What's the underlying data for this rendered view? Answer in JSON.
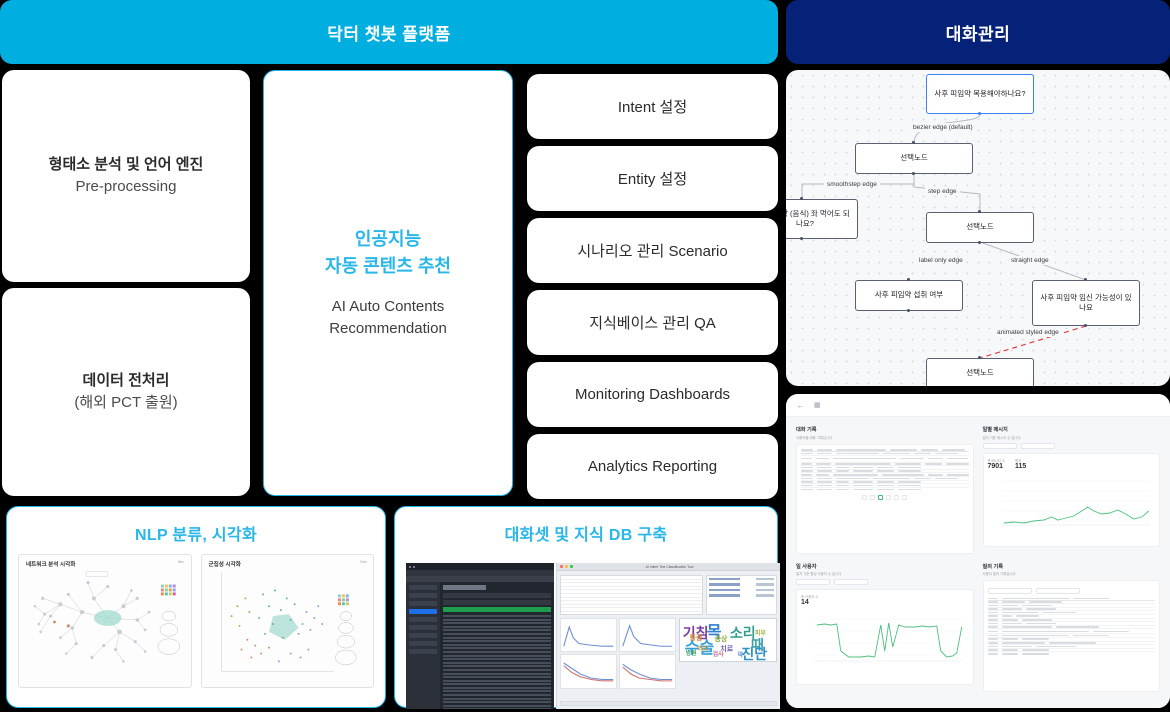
{
  "headers": {
    "left": "닥터 챗봇 플랫폼",
    "right": "대화관리"
  },
  "left_column": [
    {
      "kr": "형태소 분석 및 언어 엔진",
      "en": "Pre-processing"
    },
    {
      "kr": "데이터 전처리",
      "en": "(해외 PCT 출원)"
    }
  ],
  "center_card": {
    "title_line1": "인공지능",
    "title_line2": "자동 콘텐츠 추천",
    "sub_line1": "AI Auto Contents",
    "sub_line2": "Recommendation"
  },
  "feature_list": [
    "Intent 설정",
    "Entity 설정",
    "시나리오 관리 Scenario",
    "지식베이스 관리 QA",
    "Monitoring Dashboards",
    "Analytics Reporting"
  ],
  "nlp_panel": {
    "title": "NLP 분류, 시각화",
    "thumbs": [
      {
        "title": "네트워크 분석 시각화",
        "corner": "filter"
      },
      {
        "title": "군집성 시각화",
        "corner": "filter"
      }
    ]
  },
  "db_panel": {
    "title": "대화셋 및 지식 DB 구축",
    "tool_window_title": "AI Intent Text Classification Tool",
    "wordcloud": [
      "기침",
      "목",
      "소리",
      "때",
      "수술",
      "진단",
      "증상",
      "통증",
      "치료",
      "병원",
      "검사",
      "약",
      "피부",
      "머리"
    ]
  },
  "flowchart": {
    "nodes": [
      {
        "id": "n1",
        "text": "사후 피임약 복용해야하나요?",
        "selected": true
      },
      {
        "id": "n2",
        "text": "선택노드",
        "selected": false
      },
      {
        "id": "n3",
        "text": "임약이랑 (음식) 좌 먹어도 되나요?",
        "selected": false
      },
      {
        "id": "n4",
        "text": "선택노드",
        "selected": false
      },
      {
        "id": "n5",
        "text": "사후 피임약 섭취 여부",
        "selected": false
      },
      {
        "id": "n6",
        "text": "사후 피임약 임신 가능성이 있나요",
        "selected": false
      },
      {
        "id": "n7",
        "text": "선택노드",
        "selected": false
      }
    ],
    "edge_labels": [
      "bezier edge (default)",
      "smoothstep edge",
      "step edge",
      "label only edge",
      "straight edge",
      "animated styled edge"
    ]
  },
  "dashboard": {
    "sections": [
      {
        "heading": "대화 기록",
        "sub": "사용자별 대화 기록입니다."
      },
      {
        "heading": "일별 메시지",
        "sub": "일자 기준 메시지 수 입니다."
      },
      {
        "heading": "일 사용자",
        "sub": "일자 기준 활성 사용자 수 입니다."
      },
      {
        "heading": "질의 기록",
        "sub": "사용자 질의 기록입니다."
      }
    ],
    "kpi": [
      {
        "label": "총 메시지 수",
        "value": "7901"
      },
      {
        "label": "평균",
        "value": "115"
      },
      {
        "label": "총 사용자 수",
        "value": "14"
      }
    ],
    "pagination": [
      "«",
      "1",
      "2",
      "3",
      "4",
      "»"
    ],
    "active_page": "2"
  },
  "colors": {
    "brand_cyan": "#00AEE0",
    "accent_cyan": "#29B6E8",
    "navy": "#062278",
    "background": "#000000",
    "card": "#FFFFFF"
  }
}
